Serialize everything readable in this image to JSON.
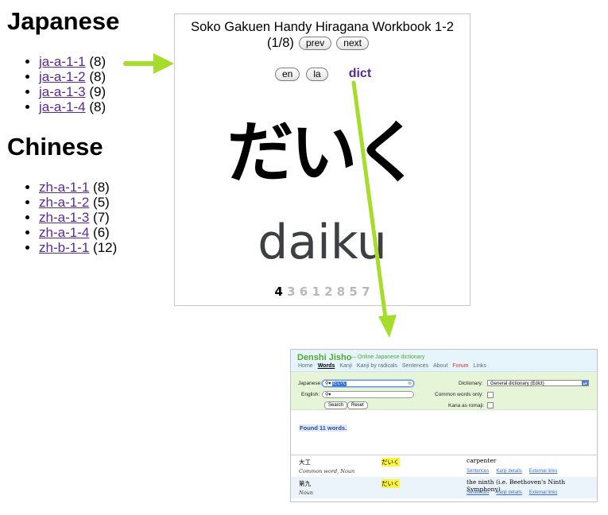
{
  "sections": [
    {
      "title": "Japanese",
      "decks": [
        {
          "label": "ja-a-1-1",
          "count": "(8)"
        },
        {
          "label": "ja-a-1-2",
          "count": "(8)"
        },
        {
          "label": "ja-a-1-3",
          "count": "(9)"
        },
        {
          "label": "ja-a-1-4",
          "count": "(8)"
        }
      ]
    },
    {
      "title": "Chinese",
      "decks": [
        {
          "label": "zh-a-1-1",
          "count": "(8)"
        },
        {
          "label": "zh-a-1-2",
          "count": "(5)"
        },
        {
          "label": "zh-a-1-3",
          "count": "(7)"
        },
        {
          "label": "zh-a-1-4",
          "count": "(6)"
        },
        {
          "label": "zh-b-1-1",
          "count": "(12)"
        }
      ]
    }
  ],
  "card": {
    "title": "Soko Gakuen Handy Hiragana Workbook 1-2",
    "position": "(1/8)",
    "prev_label": "prev",
    "next_label": "next",
    "mode_en": "en",
    "mode_la": "la",
    "dict_label": "dict",
    "kana": "だいく",
    "romaji": "daiku",
    "sequence_current": "4",
    "sequence_rest": "3 6 1 2 8 5 7"
  },
  "dictionary": {
    "brand": "Denshi Jisho",
    "tagline": "— Online Japanese dictionary",
    "tabs": [
      "Home",
      "Words",
      "Kanji",
      "Kanji by radicals",
      "Sentences",
      "About",
      "Forum",
      "Links"
    ],
    "active_tab": "Words",
    "japanese_label": "Japanese:",
    "japanese_value": "だいく",
    "english_label": "English:",
    "search_button": "Search",
    "reset_button": "Reset",
    "dictionary_label": "Dictionary:",
    "dictionary_value": "General dictionary (Edict)",
    "common_label": "Common words only:",
    "kana_label": "Kana as romaji:",
    "found_text": "Found 11 words.",
    "results": [
      {
        "kanji": "大工",
        "kana": "だいく",
        "gloss": "carpenter",
        "tags": "Common word, Noun"
      },
      {
        "kanji": "第九",
        "kana": "だいく",
        "gloss": "the ninth (i.e. Beethoven's Ninth Symphony)",
        "tags": "Noun"
      }
    ],
    "result_links": [
      "Sentences",
      "Kanji details",
      "External links"
    ]
  },
  "colors": {
    "arrow": "#a6dd2a",
    "visited_link": "#5a2a92",
    "dict_brand": "#52a82b"
  }
}
